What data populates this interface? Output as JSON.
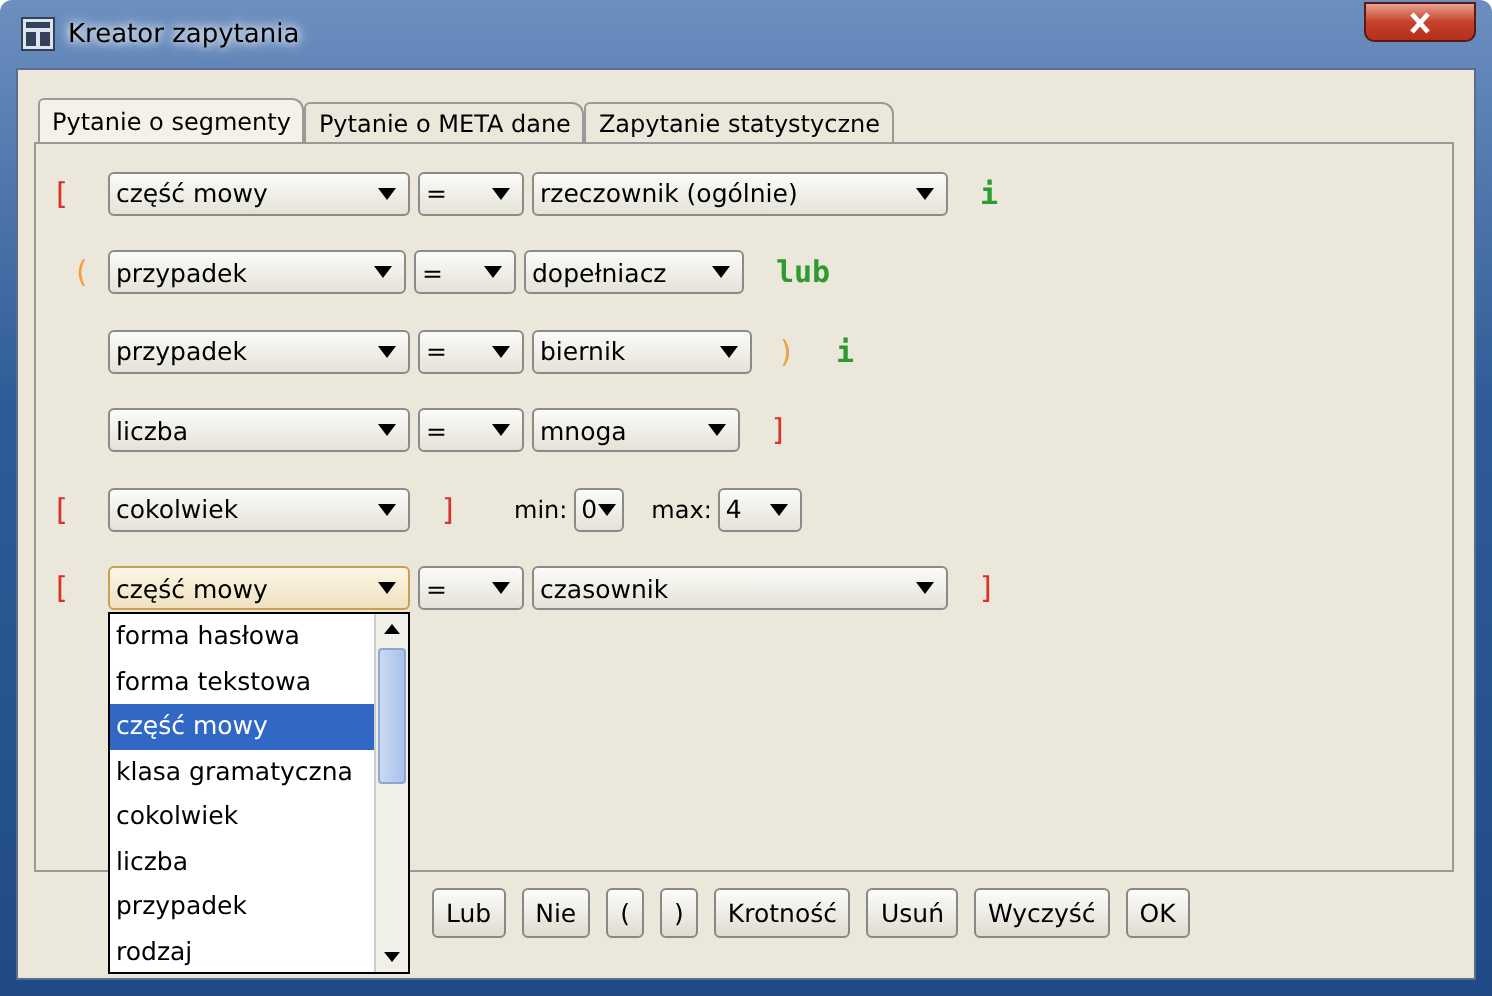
{
  "window": {
    "title": "Kreator zapytania"
  },
  "tabs": [
    {
      "label": "Pytanie o segmenty",
      "selected": true
    },
    {
      "label": "Pytanie o META dane",
      "selected": false
    },
    {
      "label": "Zapytanie statystyczne",
      "selected": false
    }
  ],
  "rows": [
    {
      "tokens": [
        {
          "kind": "bracket",
          "text": "["
        },
        {
          "kind": "combo",
          "value": "część mowy",
          "open": false
        },
        {
          "kind": "combo",
          "value": "=",
          "open": false
        },
        {
          "kind": "combo",
          "value": "rzeczownik (ogólnie)",
          "open": false
        },
        {
          "kind": "operator",
          "text": "i"
        }
      ]
    },
    {
      "tokens": [
        {
          "kind": "paren",
          "text": "("
        },
        {
          "kind": "combo",
          "value": "przypadek",
          "open": false
        },
        {
          "kind": "combo",
          "value": "=",
          "open": false
        },
        {
          "kind": "combo",
          "value": "dopełniacz",
          "open": false
        },
        {
          "kind": "operator",
          "text": "lub"
        }
      ]
    },
    {
      "tokens": [
        {
          "kind": "combo",
          "value": "przypadek",
          "open": false
        },
        {
          "kind": "combo",
          "value": "=",
          "open": false
        },
        {
          "kind": "combo",
          "value": "biernik",
          "open": false
        },
        {
          "kind": "paren",
          "text": ")"
        },
        {
          "kind": "operator",
          "text": "i"
        }
      ]
    },
    {
      "tokens": [
        {
          "kind": "combo",
          "value": "liczba",
          "open": false
        },
        {
          "kind": "combo",
          "value": "=",
          "open": false
        },
        {
          "kind": "combo",
          "value": "mnoga",
          "open": false
        },
        {
          "kind": "bracket",
          "text": "]"
        }
      ]
    },
    {
      "tokens": [
        {
          "kind": "bracket",
          "text": "["
        },
        {
          "kind": "combo",
          "value": "cokolwiek",
          "open": false
        },
        {
          "kind": "bracket",
          "text": "]"
        },
        {
          "kind": "label",
          "text": "min:"
        },
        {
          "kind": "combo",
          "value": "0",
          "open": false
        },
        {
          "kind": "label",
          "text": "max:"
        },
        {
          "kind": "combo",
          "value": "4",
          "open": false
        }
      ]
    },
    {
      "tokens": [
        {
          "kind": "bracket",
          "text": "["
        },
        {
          "kind": "combo",
          "value": "część mowy",
          "open": true
        },
        {
          "kind": "combo",
          "value": "=",
          "open": false
        },
        {
          "kind": "combo",
          "value": "czasownik",
          "open": false
        },
        {
          "kind": "bracket",
          "text": "]"
        }
      ]
    }
  ],
  "dropdown": {
    "items": [
      {
        "label": "forma hasłowa",
        "selected": false
      },
      {
        "label": "forma tekstowa",
        "selected": false
      },
      {
        "label": "część mowy",
        "selected": true
      },
      {
        "label": "klasa gramatyczna",
        "selected": false
      },
      {
        "label": "cokolwiek",
        "selected": false
      },
      {
        "label": "liczba",
        "selected": false
      },
      {
        "label": "przypadek",
        "selected": false
      },
      {
        "label": "rodzaj",
        "selected": false
      }
    ]
  },
  "buttons": [
    "Lub",
    "Nie",
    "(",
    ")",
    "Krotność",
    "Usuń",
    "Wyczyść",
    "OK"
  ]
}
